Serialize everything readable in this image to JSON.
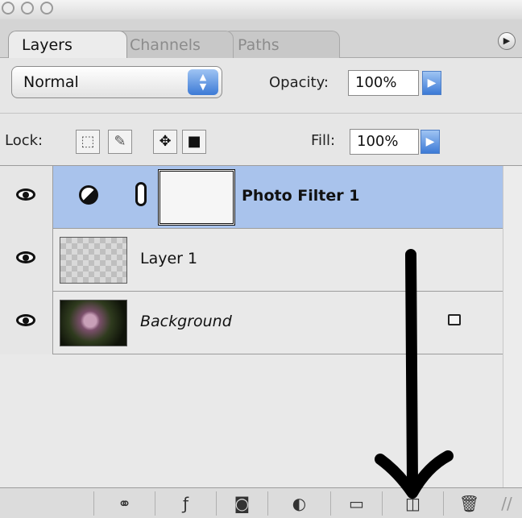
{
  "tabs": [
    "Layers",
    "Channels",
    "Paths"
  ],
  "blend_mode": "Normal",
  "opacity": {
    "label": "Opacity:",
    "value": "100%"
  },
  "lock_label": "Lock:",
  "fill": {
    "label": "Fill:",
    "value": "100%"
  },
  "layers": [
    {
      "name": "Photo Filter 1",
      "selected": true,
      "adjustment": true
    },
    {
      "name": "Layer 1",
      "selected": false,
      "thumbnail": "transparent"
    },
    {
      "name": "Background",
      "selected": false,
      "thumbnail": "photo",
      "locked": true
    }
  ],
  "toolbar_icons": [
    "link-icon",
    "layer-style-icon",
    "layer-mask-icon",
    "adjustment-layer-icon",
    "new-group-icon",
    "new-layer-icon",
    "trash-icon"
  ],
  "colors": {
    "selection": "#a9c3ec",
    "accent_blue": "#3c7ad6"
  }
}
